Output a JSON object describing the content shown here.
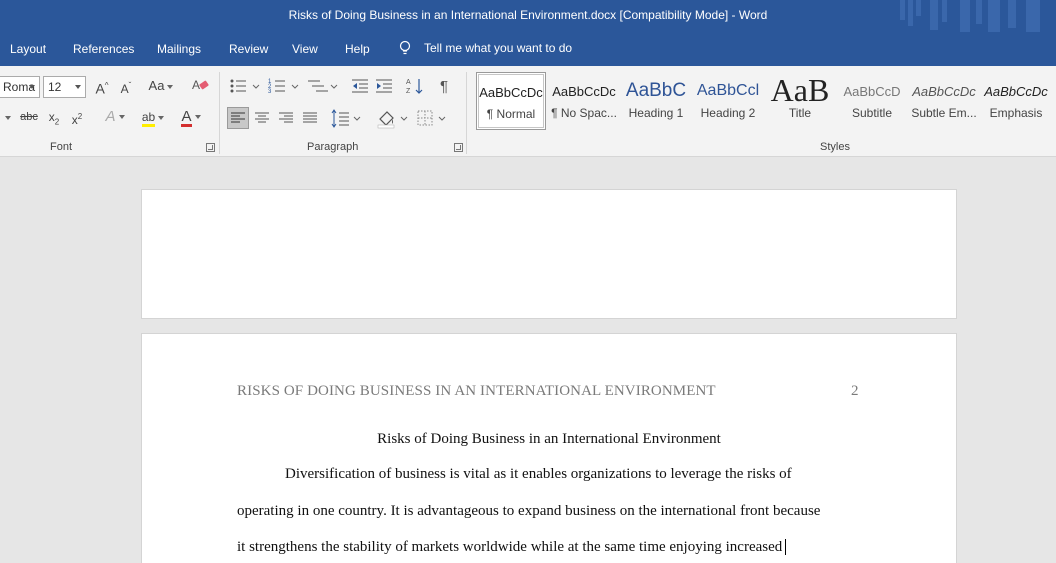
{
  "window": {
    "title": "Risks of Doing Business in an International Environment.docx [Compatibility Mode]  -  Word"
  },
  "tabs": [
    "Layout",
    "References",
    "Mailings",
    "Review",
    "View",
    "Help"
  ],
  "tell_me": "Tell me what you want to do",
  "font_group": {
    "label": "Font",
    "font_name": "Roma",
    "font_size": "12",
    "grow_label": "A",
    "shrink_label": "A",
    "case_label": "Aa",
    "strike_label": "abc",
    "subscript_label": "x",
    "superscript_label": "x",
    "effects_label": "A",
    "color_label": "A",
    "highlight_label": "ab"
  },
  "paragraph_group": {
    "label": "Paragraph"
  },
  "styles_group": {
    "label": "Styles",
    "items": [
      {
        "sample": "AaBbCcDc",
        "name": "¶ Normal"
      },
      {
        "sample": "AaBbCcDc",
        "name": "¶ No Spac..."
      },
      {
        "sample": "AaBbC",
        "name": "Heading 1"
      },
      {
        "sample": "AaBbCcl",
        "name": "Heading 2"
      },
      {
        "sample": "AaB",
        "name": "Title"
      },
      {
        "sample": "AaBbCcD",
        "name": "Subtitle"
      },
      {
        "sample": "AaBbCcDc",
        "name": "Subtle Em..."
      },
      {
        "sample": "AaBbCcDc",
        "name": "Emphasis"
      }
    ]
  },
  "document": {
    "running_header": "RISKS OF DOING BUSINESS IN AN INTERNATIONAL ENVIRONMENT",
    "page_number": "2",
    "title": "Risks of Doing Business in an International Environment",
    "lines": [
      "Diversification of business is vital as it enables organizations to leverage the risks of",
      "operating in one country. It is advantageous to expand business on the international front because",
      "it strengthens the stability of markets worldwide while at the same time enjoying increased"
    ]
  },
  "colors": {
    "title_bar": "#2b579a",
    "ribbon": "#f3f3f3",
    "canvas": "#e6e6e6",
    "font_color_underline": "#d32f2f",
    "highlight_underline": "#ffee00"
  }
}
